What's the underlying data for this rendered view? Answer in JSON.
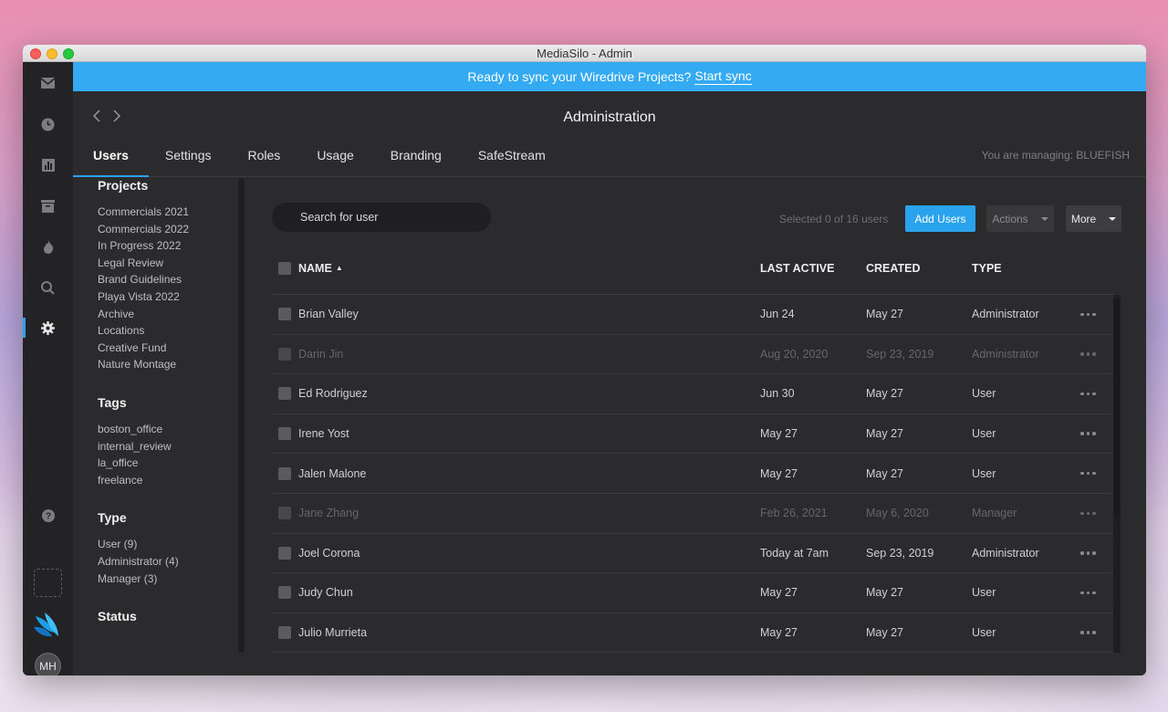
{
  "window": {
    "title": "MediaSilo - Admin"
  },
  "rail": {
    "icons": [
      "mail-icon",
      "clock-icon",
      "chart-icon",
      "archive-icon",
      "flame-icon",
      "search-icon",
      "gear-icon",
      "help-icon"
    ],
    "active": "gear-icon",
    "avatar_initials": "MH"
  },
  "banner": {
    "text": "Ready to sync your Wiredrive Projects?",
    "link": "Start sync",
    "color": "#33aaf1"
  },
  "header": {
    "title": "Administration",
    "tabs": [
      "Users",
      "Settings",
      "Roles",
      "Usage",
      "Branding",
      "SafeStream"
    ],
    "active_tab": "Users",
    "managing_text": "You are managing: BLUEFISH"
  },
  "filters": {
    "projects": {
      "title": "Projects",
      "items": [
        "Commercials 2021",
        "Commercials 2022",
        "In Progress 2022",
        "Legal Review",
        "Brand Guidelines",
        "Playa Vista 2022",
        "Archive",
        "Locations",
        "Creative Fund",
        "Nature Montage"
      ]
    },
    "tags": {
      "title": "Tags",
      "items": [
        "boston_office",
        "internal_review",
        "la_office",
        "freelance"
      ]
    },
    "type": {
      "title": "Type",
      "items": [
        "User (9)",
        "Administrator (4)",
        "Manager (3)"
      ]
    },
    "status": {
      "title": "Status"
    }
  },
  "toolbar": {
    "search_placeholder": "Search for user",
    "selected_info": "Selected 0 of 16 users",
    "add_users_label": "Add Users",
    "actions_label": "Actions",
    "more_label": "More"
  },
  "table": {
    "columns": {
      "name": "NAME",
      "last_active": "LAST ACTIVE",
      "created": "CREATED",
      "type": "TYPE"
    },
    "sort_indicator": "▲",
    "rows": [
      {
        "name": "Brian Valley",
        "last_active": "Jun 24",
        "created": "May 27",
        "type": "Administrator",
        "dim": false
      },
      {
        "name": "Darin Jin",
        "last_active": "Aug 20, 2020",
        "created": "Sep 23, 2019",
        "type": "Administrator",
        "dim": true
      },
      {
        "name": "Ed Rodriguez",
        "last_active": "Jun 30",
        "created": "May 27",
        "type": "User",
        "dim": false
      },
      {
        "name": "Irene Yost",
        "last_active": "May 27",
        "created": "May 27",
        "type": "User",
        "dim": false
      },
      {
        "name": "Jalen Malone",
        "last_active": "May 27",
        "created": "May 27",
        "type": "User",
        "dim": false
      },
      {
        "name": "Jane Zhang",
        "last_active": "Feb 26, 2021",
        "created": "May 6, 2020",
        "type": "Manager",
        "dim": true
      },
      {
        "name": "Joel Corona",
        "last_active": "Today at 7am",
        "created": "Sep 23, 2019",
        "type": "Administrator",
        "dim": false
      },
      {
        "name": "Judy Chun",
        "last_active": "May 27",
        "created": "May 27",
        "type": "User",
        "dim": false
      },
      {
        "name": "Julio Murrieta",
        "last_active": "May 27",
        "created": "May 27",
        "type": "User",
        "dim": false
      }
    ]
  }
}
